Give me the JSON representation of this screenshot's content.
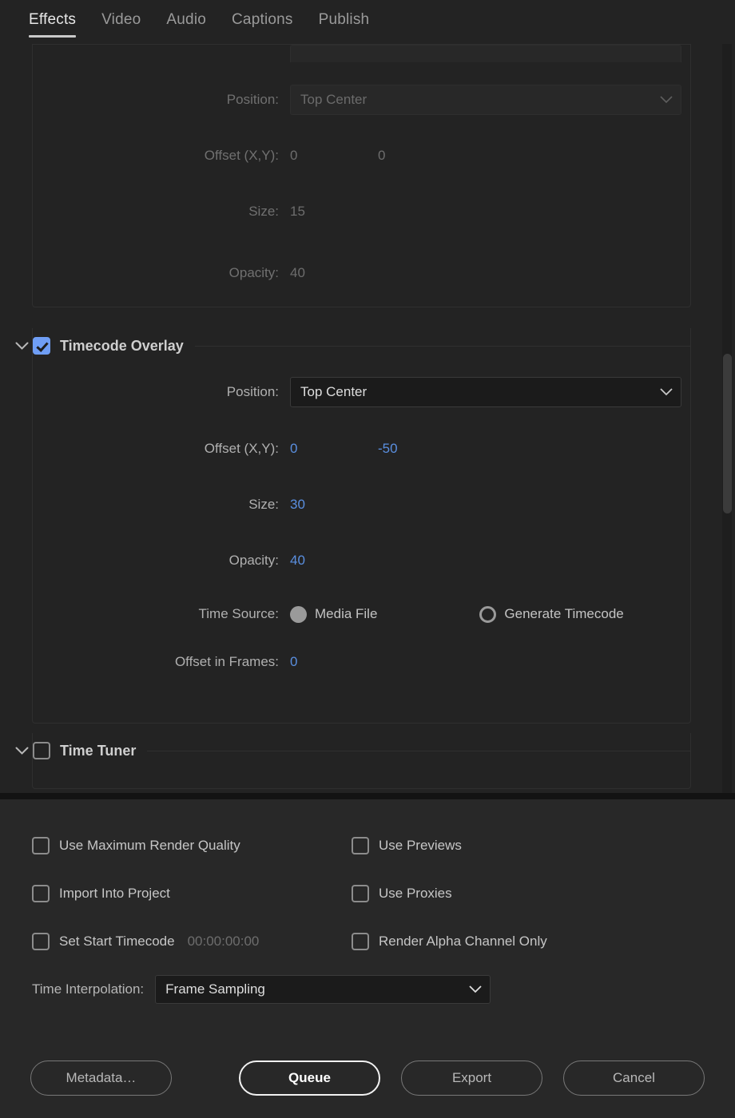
{
  "tabs": [
    {
      "label": "Effects",
      "active": true
    },
    {
      "label": "Video",
      "active": false
    },
    {
      "label": "Audio",
      "active": false
    },
    {
      "label": "Captions",
      "active": false
    },
    {
      "label": "Publish",
      "active": false
    }
  ],
  "sections": {
    "image_overlay": {
      "enabled": false,
      "position": {
        "label": "Position:",
        "value": "Top Center"
      },
      "offset": {
        "label": "Offset (X,Y):",
        "x": "0",
        "y": "0"
      },
      "size": {
        "label": "Size:",
        "value": "15"
      },
      "opacity": {
        "label": "Opacity:",
        "value": "40"
      }
    },
    "timecode_overlay": {
      "title": "Timecode Overlay",
      "checked": true,
      "position": {
        "label": "Position:",
        "value": "Top Center"
      },
      "offset": {
        "label": "Offset (X,Y):",
        "x": "0",
        "y": "-50"
      },
      "size": {
        "label": "Size:",
        "value": "30"
      },
      "opacity": {
        "label": "Opacity:",
        "value": "40"
      },
      "time_source": {
        "label": "Time Source:",
        "option_media": "Media File",
        "option_generate": "Generate Timecode",
        "selected": "Media File"
      },
      "offset_in_frames": {
        "label": "Offset in Frames:",
        "value": "0"
      }
    },
    "time_tuner": {
      "title": "Time Tuner",
      "checked": false
    }
  },
  "bottom": {
    "checkboxes": [
      {
        "label": "Use Maximum Render Quality",
        "checked": false
      },
      {
        "label": "Use Previews",
        "checked": false
      },
      {
        "label": "Import Into Project",
        "checked": false
      },
      {
        "label": "Use Proxies",
        "checked": false
      },
      {
        "label": "Set Start Timecode",
        "checked": false,
        "value": "00:00:00:00"
      },
      {
        "label": "Render Alpha Channel Only",
        "checked": false
      }
    ],
    "time_interpolation": {
      "label": "Time Interpolation:",
      "value": "Frame Sampling"
    },
    "buttons": {
      "metadata": "Metadata…",
      "queue": "Queue",
      "export": "Export",
      "cancel": "Cancel"
    }
  },
  "colors": {
    "accent_blue": "#5a8fe0",
    "checkbox_blue": "#6f9ef5",
    "panel_bg": "#232323",
    "bottom_bg": "#282828"
  }
}
